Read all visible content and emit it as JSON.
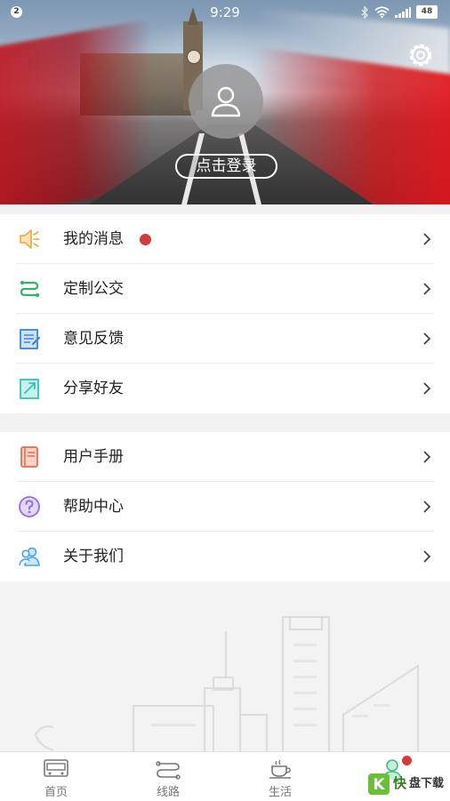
{
  "status_bar": {
    "notification_count": "2",
    "time": "9:29",
    "battery": "48"
  },
  "header": {
    "login_label": "点击登录"
  },
  "menu_group_1": [
    {
      "label": "我的消息",
      "icon": "megaphone-icon",
      "has_dot": true
    },
    {
      "label": "定制公交",
      "icon": "route-icon"
    },
    {
      "label": "意见反馈",
      "icon": "feedback-note-icon"
    },
    {
      "label": "分享好友",
      "icon": "share-icon"
    }
  ],
  "menu_group_2": [
    {
      "label": "用户手册",
      "icon": "manual-book-icon"
    },
    {
      "label": "帮助中心",
      "icon": "help-question-icon"
    },
    {
      "label": "关于我们",
      "icon": "users-icon"
    }
  ],
  "tabs": [
    {
      "label": "首页",
      "icon": "bus-icon"
    },
    {
      "label": "线路",
      "icon": "route-line-icon"
    },
    {
      "label": "生活",
      "icon": "coffee-cup-icon"
    },
    {
      "label": "",
      "icon": "profile-icon",
      "active": true
    }
  ],
  "watermark": {
    "text": "盘下载"
  },
  "colors": {
    "accent_red": "#d33a3a",
    "active_green": "#3fbf7f"
  }
}
